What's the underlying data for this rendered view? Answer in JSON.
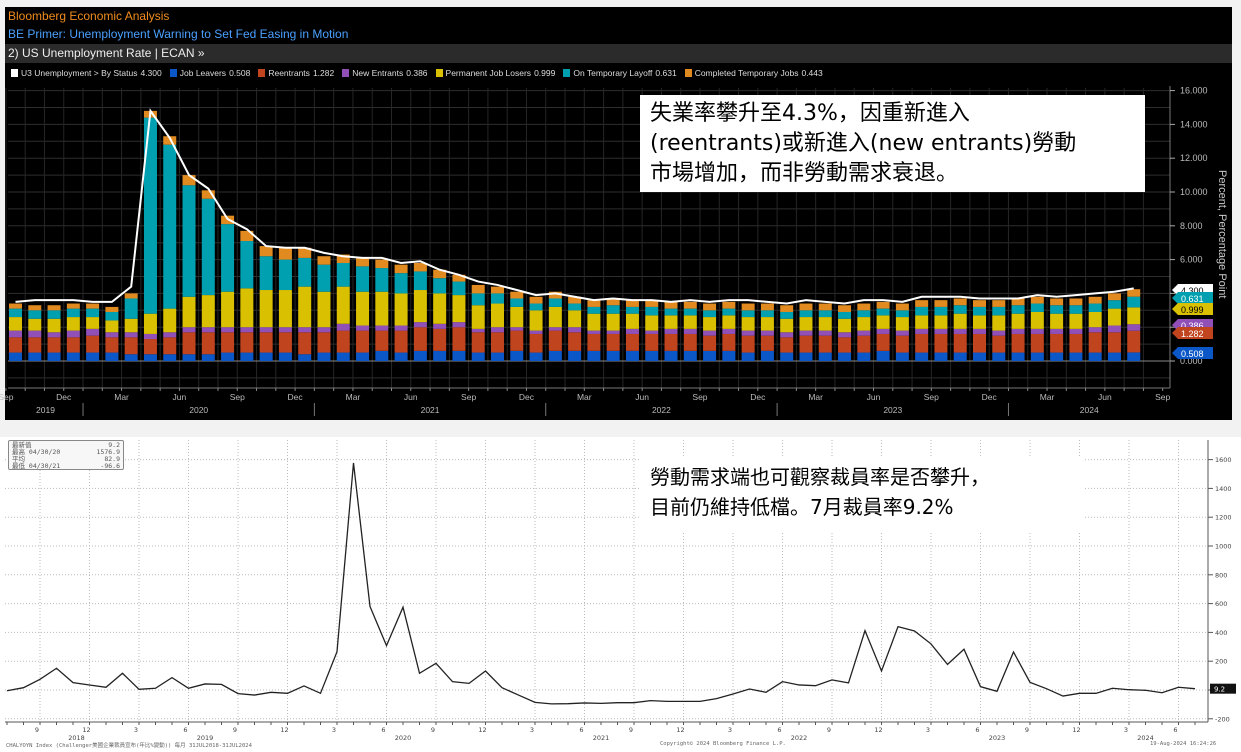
{
  "header": {
    "source": "Bloomberg Economic Analysis",
    "headline": "BE Primer: Unemployment Warning to Set Fed Easing in Motion",
    "chart_title": "2) US Unemployment Rate | ECAN »"
  },
  "legend": [
    {
      "label": "U3 Unemployment > By Status",
      "value": "4.300",
      "color": "#ffffff"
    },
    {
      "label": "Job Leavers",
      "value": "0.508",
      "color": "#0b57c7"
    },
    {
      "label": "Reentrants",
      "value": "1.282",
      "color": "#c0441e"
    },
    {
      "label": "New Entrants",
      "value": "0.386",
      "color": "#9050b8"
    },
    {
      "label": "Permanent Job Losers",
      "value": "0.999",
      "color": "#d9c000"
    },
    {
      "label": "On Temporary Layoff",
      "value": "0.631",
      "color": "#00a0b0"
    },
    {
      "label": "Completed Temporary Jobs",
      "value": "0.443",
      "color": "#e08a20"
    }
  ],
  "annotations": {
    "top": [
      "失業率攀升至4.3%，因重新進入",
      "(reentrants)或新進入(new entrants)勞動",
      "市場增加，而非勞動需求衰退。"
    ],
    "bottom": [
      "勞動需求端也可觀察裁員率是否攀升，",
      "目前仍維持低檔。7月裁員率9.2%"
    ]
  },
  "stats_box": {
    "rows": [
      {
        "label": "最新值",
        "date": "",
        "value": "9.2"
      },
      {
        "label": "最高",
        "date": "04/30/20",
        "value": "1576.9"
      },
      {
        "label": "平均",
        "date": "",
        "value": "82.9"
      },
      {
        "label": "最低",
        "date": "04/30/21",
        "value": "-96.6"
      }
    ]
  },
  "footer": {
    "left": "CHALYOYN Index (Challenger美國企業裁員宣布(年比%變動)) 每月 31JUL2018-31JUL2024",
    "center": "Copyright© 2024 Bloomberg Finance L.P.",
    "right": "19-Aug-2024 16:24:26"
  },
  "chart_data": [
    {
      "type": "bar",
      "stacked": true,
      "title": "US Unemployment Rate",
      "ylabel": "Percent, Percentage Point",
      "ylim": [
        -1.6,
        16.5
      ],
      "yticks": [
        "0.000",
        "2.000",
        "4.000",
        "6.000",
        "8.000",
        "10.000",
        "12.000",
        "14.000",
        "16.000"
      ],
      "grid": true,
      "x_start": "2019-09",
      "x_end": "2024-07",
      "xtick_months": [
        "Dec",
        "Mar",
        "Jun",
        "Sep"
      ],
      "xtick_years": [
        "2019",
        "2020",
        "2021",
        "2022",
        "2023",
        "2024"
      ],
      "last_value_tags": [
        {
          "value": "4.300",
          "color": "#ffffff"
        },
        {
          "value": "0.631",
          "color": "#00a0b0"
        },
        {
          "value": "0.999",
          "color": "#d9c000"
        },
        {
          "value": "0.386",
          "color": "#9050b8"
        },
        {
          "value": "1.282",
          "color": "#c0441e"
        },
        {
          "value": "0.508",
          "color": "#0b57c7"
        }
      ],
      "line": {
        "name": "U3 Unemployment > By Status",
        "color": "#ffffff",
        "values": [
          3.5,
          3.6,
          3.6,
          3.6,
          3.5,
          3.5,
          4.4,
          14.8,
          13.2,
          11.0,
          10.2,
          8.4,
          7.8,
          6.8,
          6.7,
          6.7,
          6.4,
          6.2,
          6.1,
          6.1,
          5.8,
          5.9,
          5.4,
          5.1,
          4.7,
          4.5,
          4.2,
          3.9,
          4.0,
          3.8,
          3.6,
          3.7,
          3.6,
          3.6,
          3.5,
          3.6,
          3.5,
          3.6,
          3.6,
          3.5,
          3.4,
          3.6,
          3.5,
          3.4,
          3.6,
          3.6,
          3.5,
          3.8,
          3.8,
          3.8,
          3.7,
          3.7,
          3.7,
          3.9,
          3.8,
          3.9,
          4.0,
          4.1,
          4.3
        ]
      },
      "series": [
        {
          "name": "Job Leavers",
          "color": "#0b57c7",
          "values": [
            0.5,
            0.5,
            0.5,
            0.5,
            0.5,
            0.5,
            0.4,
            0.4,
            0.4,
            0.4,
            0.4,
            0.5,
            0.5,
            0.5,
            0.5,
            0.4,
            0.5,
            0.5,
            0.5,
            0.6,
            0.5,
            0.6,
            0.6,
            0.6,
            0.5,
            0.5,
            0.6,
            0.5,
            0.6,
            0.6,
            0.6,
            0.6,
            0.6,
            0.6,
            0.6,
            0.6,
            0.6,
            0.6,
            0.5,
            0.6,
            0.5,
            0.5,
            0.5,
            0.5,
            0.5,
            0.6,
            0.5,
            0.5,
            0.5,
            0.5,
            0.5,
            0.5,
            0.5,
            0.5,
            0.5,
            0.5,
            0.5,
            0.5,
            0.508
          ]
        },
        {
          "name": "Reentrants",
          "color": "#c0441e",
          "values": [
            0.9,
            0.9,
            0.9,
            0.9,
            1.0,
            0.9,
            1.0,
            0.9,
            1.0,
            1.3,
            1.3,
            1.2,
            1.2,
            1.2,
            1.2,
            1.3,
            1.2,
            1.3,
            1.3,
            1.2,
            1.3,
            1.4,
            1.3,
            1.4,
            1.2,
            1.2,
            1.2,
            1.1,
            1.2,
            1.1,
            1.0,
            1.0,
            1.0,
            1.0,
            1.0,
            1.0,
            0.9,
            1.0,
            1.0,
            0.9,
            0.9,
            1.0,
            1.0,
            0.9,
            1.0,
            1.0,
            1.0,
            1.1,
            1.1,
            1.1,
            1.1,
            1.0,
            1.1,
            1.1,
            1.1,
            1.1,
            1.2,
            1.2,
            1.282
          ]
        },
        {
          "name": "New Entrants",
          "color": "#9050b8",
          "values": [
            0.4,
            0.4,
            0.3,
            0.4,
            0.4,
            0.3,
            0.3,
            0.3,
            0.3,
            0.3,
            0.3,
            0.3,
            0.3,
            0.3,
            0.3,
            0.3,
            0.3,
            0.4,
            0.3,
            0.3,
            0.3,
            0.3,
            0.3,
            0.3,
            0.2,
            0.3,
            0.2,
            0.2,
            0.2,
            0.3,
            0.2,
            0.2,
            0.3,
            0.2,
            0.3,
            0.3,
            0.3,
            0.3,
            0.3,
            0.3,
            0.3,
            0.3,
            0.3,
            0.3,
            0.3,
            0.3,
            0.3,
            0.3,
            0.3,
            0.3,
            0.3,
            0.3,
            0.3,
            0.3,
            0.3,
            0.3,
            0.3,
            0.4,
            0.386
          ]
        },
        {
          "name": "Permanent Job Losers",
          "color": "#d9c000",
          "values": [
            0.8,
            0.7,
            0.8,
            0.8,
            0.7,
            0.7,
            0.8,
            1.2,
            1.4,
            1.8,
            1.9,
            2.1,
            2.3,
            2.2,
            2.2,
            2.4,
            2.1,
            2.2,
            2.0,
            2.0,
            1.9,
            1.9,
            1.8,
            1.6,
            1.4,
            1.4,
            1.2,
            1.2,
            1.2,
            1.0,
            1.0,
            1.0,
            0.9,
            0.9,
            0.8,
            0.8,
            0.8,
            0.8,
            0.8,
            0.8,
            0.8,
            0.8,
            0.8,
            0.8,
            0.8,
            0.8,
            0.8,
            0.8,
            0.8,
            0.9,
            0.8,
            0.9,
            0.9,
            1.0,
            0.9,
            0.9,
            0.9,
            1.0,
            0.999
          ]
        },
        {
          "name": "On Temporary Layoff",
          "color": "#00a0b0",
          "values": [
            0.5,
            0.5,
            0.5,
            0.5,
            0.5,
            0.5,
            1.2,
            11.6,
            9.7,
            6.6,
            5.7,
            4.0,
            2.8,
            2.0,
            1.8,
            1.7,
            1.6,
            1.4,
            1.5,
            1.4,
            1.2,
            1.1,
            0.9,
            0.8,
            0.7,
            0.6,
            0.5,
            0.4,
            0.5,
            0.4,
            0.4,
            0.5,
            0.4,
            0.5,
            0.4,
            0.4,
            0.4,
            0.4,
            0.4,
            0.4,
            0.4,
            0.4,
            0.4,
            0.4,
            0.4,
            0.4,
            0.4,
            0.5,
            0.5,
            0.5,
            0.5,
            0.5,
            0.5,
            0.5,
            0.5,
            0.5,
            0.5,
            0.5,
            0.631
          ]
        },
        {
          "name": "Completed Temporary Jobs",
          "color": "#e08a20",
          "values": [
            0.3,
            0.3,
            0.3,
            0.3,
            0.3,
            0.3,
            0.3,
            0.4,
            0.5,
            0.6,
            0.5,
            0.5,
            0.6,
            0.6,
            0.7,
            0.6,
            0.5,
            0.5,
            0.5,
            0.5,
            0.5,
            0.5,
            0.5,
            0.4,
            0.5,
            0.4,
            0.4,
            0.4,
            0.4,
            0.4,
            0.4,
            0.4,
            0.4,
            0.4,
            0.4,
            0.4,
            0.4,
            0.4,
            0.4,
            0.4,
            0.4,
            0.4,
            0.4,
            0.4,
            0.4,
            0.4,
            0.4,
            0.4,
            0.4,
            0.4,
            0.4,
            0.4,
            0.4,
            0.4,
            0.4,
            0.4,
            0.4,
            0.4,
            0.443
          ]
        }
      ]
    },
    {
      "type": "line",
      "title": "",
      "ylim": [
        -200,
        1700
      ],
      "yticks": [
        "-200",
        "0",
        "200",
        "400",
        "600",
        "800",
        "1000",
        "1200",
        "1400",
        "1600"
      ],
      "grid": true,
      "x_start": "2018-07",
      "x_end": "2024-07",
      "xtick_months": [
        "9",
        "12",
        "3",
        "6"
      ],
      "xtick_years": [
        "2018",
        "2019",
        "2020",
        "2021",
        "2022",
        "2023",
        "2024"
      ],
      "last_value_tag": "9.2",
      "color": "#222222",
      "values": [
        -5,
        16,
        74,
        151,
        51,
        35,
        19,
        116,
        5,
        12,
        86,
        12,
        42,
        39,
        -25,
        -35,
        -16,
        -23,
        28,
        -23,
        266,
        1576.9,
        580,
        308,
        575,
        116,
        185,
        58,
        46,
        132,
        16,
        -35,
        -86,
        -96.6,
        -95,
        -90,
        -93,
        -88,
        -88,
        -74,
        -79,
        -79,
        -79,
        -60,
        -28,
        7,
        -16,
        58,
        35,
        30,
        70,
        49,
        412,
        132,
        440,
        410,
        320,
        178,
        283,
        23,
        -9,
        264,
        53,
        9,
        -42,
        -23,
        -23,
        12,
        2,
        -2,
        -19,
        19,
        9.2
      ]
    }
  ]
}
